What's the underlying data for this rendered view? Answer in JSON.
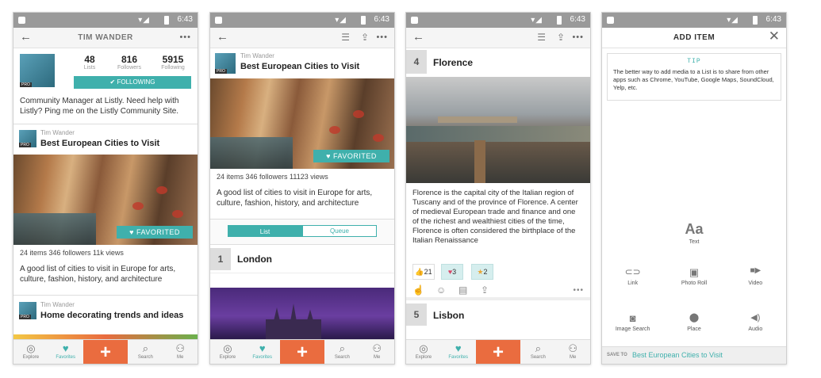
{
  "status": {
    "time": "6:43"
  },
  "p1": {
    "title": "TIM WANDER",
    "stats": [
      {
        "value": "48",
        "label": "Lists"
      },
      {
        "value": "816",
        "label": "Followers"
      },
      {
        "value": "5915",
        "label": "Following"
      }
    ],
    "follow_label": "FOLLOWING",
    "bio": "Community Manager at Listly. Need help with Listly? Ping me on the Listly Community Site.",
    "card1": {
      "author": "Tim Wander",
      "title": "Best European Cities to Visit",
      "fav": "FAVORITED",
      "stats": "24 items   346 followers   11k views",
      "desc": "A good list of cities to visit in Europe for arts, culture, fashion, history, and architecture"
    },
    "card2": {
      "author": "Tim Wander",
      "title": "Home decorating trends and ideas"
    }
  },
  "p2": {
    "author": "Tim Wander",
    "title": "Best European Cities to Visit",
    "fav": "FAVORITED",
    "stats": "24 items   346 followers   11123 views",
    "desc": "A good list of cities to visit in Europe for arts, culture, fashion, history, and architecture",
    "seg": [
      "List",
      "Queue"
    ],
    "item": {
      "num": "1",
      "name": "London"
    }
  },
  "p3": {
    "item": {
      "num": "4",
      "name": "Florence"
    },
    "desc": "Florence is the capital city of the Italian region of Tuscany and of the province of Florence. A center of medieval European trade and finance and one of the richest and wealthiest cities of the time, Florence is often considered the birthplace of the Italian Renaissance",
    "reactions": [
      {
        "icon": "👍",
        "count": "21"
      },
      {
        "icon": "♥",
        "count": "3"
      },
      {
        "icon": "★",
        "count": "2"
      }
    ],
    "next": {
      "num": "5",
      "name": "Lisbon"
    }
  },
  "p4": {
    "title": "ADD ITEM",
    "tip_label": "TIP",
    "tip": "The better way to add media to a List is to share from other apps such as Chrome, YouTube, Google Maps, SoundCloud, Yelp, etc.",
    "text_glyph": "Aa",
    "text_label": "Text",
    "opts": [
      {
        "label": "Link",
        "glyph": "⊂⊃"
      },
      {
        "label": "Photo Roll",
        "glyph": "▣"
      },
      {
        "label": "Video",
        "glyph": "■▶"
      },
      {
        "label": "Image Search",
        "glyph": "◙"
      },
      {
        "label": "Place",
        "glyph": "⬤"
      },
      {
        "label": "Audio",
        "glyph": "◀)"
      }
    ],
    "save_to_label": "SAVE TO",
    "save_to_value": "Best European Cities to Visit"
  },
  "nav": {
    "explore": "Explore",
    "favorites": "Favorites",
    "add": "+",
    "search": "Search",
    "me": "Me"
  },
  "colors": {
    "accent": "#3fb0ac",
    "add": "#ea6c3f"
  }
}
